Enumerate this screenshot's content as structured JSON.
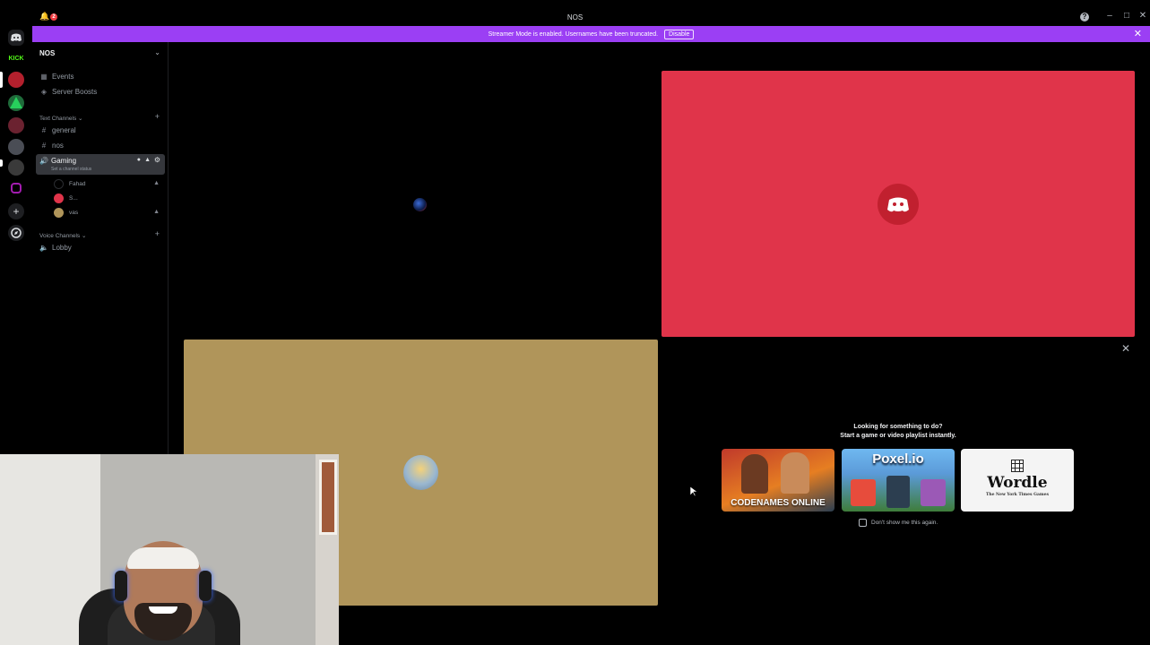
{
  "window": {
    "title": "NOS",
    "notification_count": "2"
  },
  "banner": {
    "message": "Streamer Mode is enabled. Usernames have been truncated.",
    "disable_label": "Disable"
  },
  "server": {
    "name": "NOS",
    "events_label": "Events",
    "boosts_label": "Server Boosts"
  },
  "text_category": "Text Channels",
  "text_channels": [
    {
      "label": "general"
    },
    {
      "label": "nos"
    }
  ],
  "active_channel": {
    "label": "Gaming",
    "status_hint": "Set a channel status"
  },
  "voice_members": [
    {
      "name": "Fahad"
    },
    {
      "name": "S..."
    },
    {
      "name": "vas"
    }
  ],
  "voice_category": "Voice Channels",
  "voice_channels": [
    {
      "label": "Lobby"
    }
  ],
  "activity": {
    "headline": "Looking for something to do?",
    "subline": "Start a game or video playlist instantly.",
    "dont_show": "Don't show me this again.",
    "games": [
      {
        "title": "CODENAMES ONLINE"
      },
      {
        "title": "Poxel.io"
      },
      {
        "title": "Wordle",
        "subtitle": "The New York Times Games"
      }
    ]
  },
  "rail": {
    "kick_label": "KICK"
  },
  "colors": {
    "accent_banner": "#9b3ff4",
    "tile_red": "#e0344a",
    "tile_gold": "#b0955a"
  }
}
